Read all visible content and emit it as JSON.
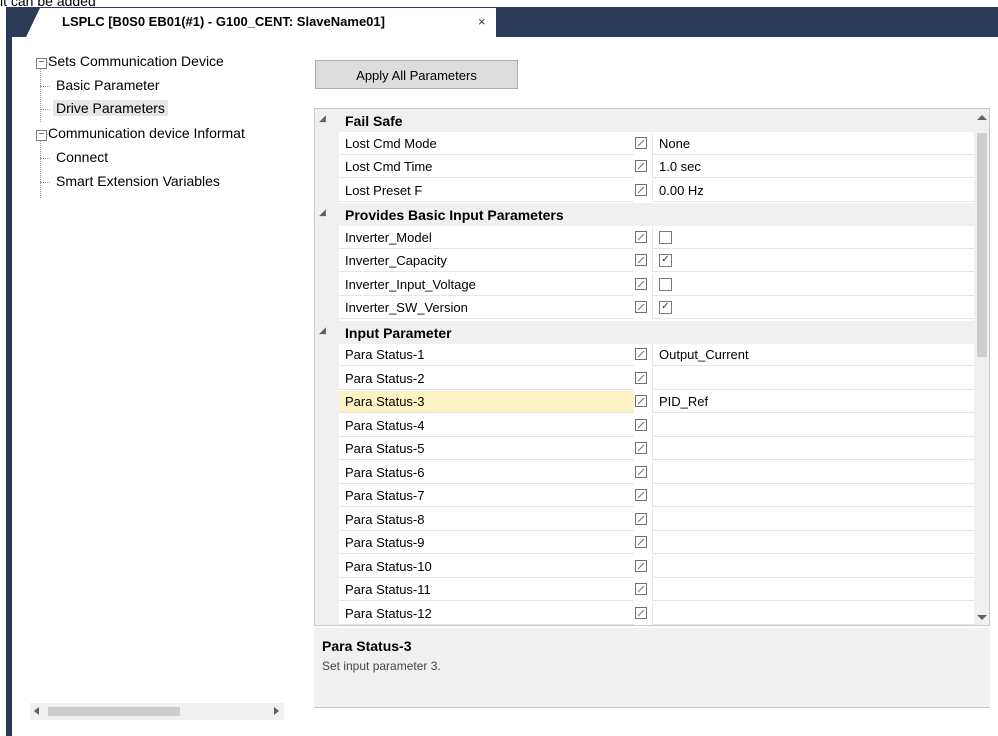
{
  "top_caption": "it can be added",
  "tab": {
    "title": "LSPLC [B0S0 EB01(#1) - G100_CENT: SlaveName01]",
    "close": "×"
  },
  "tree": {
    "root1": {
      "label": "Sets Communication Device",
      "expander": "−"
    },
    "basic_parameter": "Basic Parameter",
    "drive_parameters": "Drive Parameters",
    "root2": {
      "label": "Communication device Informat",
      "expander": "−"
    },
    "connect": "Connect",
    "smart_extension": "Smart Extension Variables"
  },
  "apply_button": "Apply All Parameters",
  "grid": {
    "categories": {
      "fail_safe": "Fail Safe",
      "basic_input": "Provides Basic Input Parameters",
      "input_parameter": "Input Parameter"
    },
    "rows": [
      {
        "name": "Lost Cmd Mode",
        "value": "None"
      },
      {
        "name": "Lost Cmd Time",
        "value": "1.0 sec"
      },
      {
        "name": "Lost Preset F",
        "value": "0.00 Hz"
      },
      {
        "name": "Inverter_Model",
        "checked": false
      },
      {
        "name": "Inverter_Capacity",
        "checked": true
      },
      {
        "name": "Inverter_Input_Voltage",
        "checked": false
      },
      {
        "name": "Inverter_SW_Version",
        "checked": true
      },
      {
        "name": "Para Status-1",
        "value": "Output_Current"
      },
      {
        "name": "Para Status-2",
        "value": ""
      },
      {
        "name": "Para Status-3",
        "value": "PID_Ref"
      },
      {
        "name": "Para Status-4",
        "value": ""
      },
      {
        "name": "Para Status-5",
        "value": ""
      },
      {
        "name": "Para Status-6",
        "value": ""
      },
      {
        "name": "Para Status-7",
        "value": ""
      },
      {
        "name": "Para Status-8",
        "value": ""
      },
      {
        "name": "Para Status-9",
        "value": ""
      },
      {
        "name": "Para Status-10",
        "value": ""
      },
      {
        "name": "Para Status-11",
        "value": ""
      },
      {
        "name": "Para Status-12",
        "value": ""
      }
    ],
    "check_mark": "✓"
  },
  "help": {
    "title": "Para Status-3",
    "description": "Set input parameter 3."
  },
  "colors": {
    "tab_bar": "#2b3a57",
    "selected_row": "#fdf2c4",
    "category_bg": "#f0f0f0"
  }
}
